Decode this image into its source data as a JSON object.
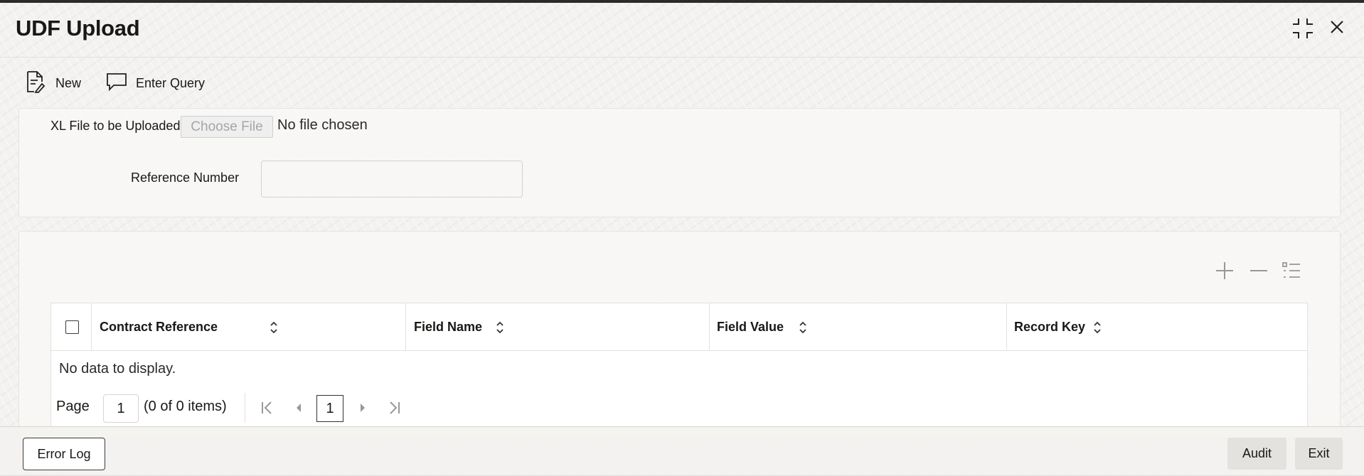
{
  "window": {
    "title": "UDF Upload",
    "controls": [
      {
        "name": "minimize-icon"
      },
      {
        "name": "close-icon"
      }
    ]
  },
  "toolbar": {
    "new_label": "New",
    "new_icon": "new-document-icon",
    "enter_query_label": "Enter Query",
    "enter_query_icon": "speech-bubble-icon"
  },
  "form": {
    "xl_file_label": "XL File to be Uploaded",
    "choose_file_label": "Choose File",
    "file_status": "No file chosen",
    "reference_number_label": "Reference Number",
    "reference_number_value": ""
  },
  "grid": {
    "actions": [
      "add-row-icon",
      "remove-row-icon",
      "column-settings-icon"
    ],
    "columns": [
      "Contract Reference",
      "Field Name",
      "Field Value",
      "Record Key"
    ],
    "empty_message": "No data to display.",
    "pager": {
      "page_label": "Page",
      "page_value": "1",
      "items_info": "(0 of 0 items)",
      "current_page": "1"
    }
  },
  "footer": {
    "error_log_label": "Error Log",
    "audit_label": "Audit",
    "exit_label": "Exit"
  },
  "colors": {
    "background": "#f3f2f0",
    "text": "#1a1816",
    "button_gray": "#e4e2df"
  }
}
